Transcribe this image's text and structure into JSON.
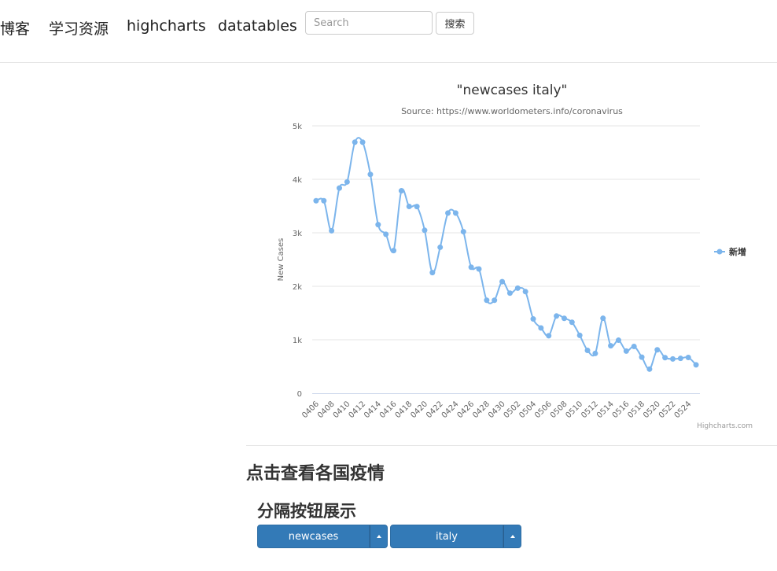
{
  "nav": {
    "blog": "博客",
    "resources": "学习资源",
    "highcharts": "highcharts",
    "datatables": "datatables"
  },
  "search": {
    "placeholder": "Search",
    "button_label": "搜索"
  },
  "chart_data": {
    "type": "line",
    "title": "\"newcases italy\"",
    "subtitle": "Source: https://www.worldometers.info/coronavirus",
    "ylabel": "New Cases",
    "xlabel": "",
    "ylim": [
      0,
      5000
    ],
    "yticks": [
      0,
      1000,
      2000,
      3000,
      4000,
      5000
    ],
    "ytick_labels": [
      "0",
      "1k",
      "2k",
      "3k",
      "4k",
      "5k"
    ],
    "grid": true,
    "legend_position": "right",
    "credits": "Highcharts.com",
    "color": "#7cb5ec",
    "categories": [
      "0406",
      "0407",
      "0408",
      "0409",
      "0410",
      "0411",
      "0412",
      "0413",
      "0414",
      "0415",
      "0416",
      "0417",
      "0418",
      "0419",
      "0420",
      "0421",
      "0422",
      "0423",
      "0424",
      "0425",
      "0426",
      "0427",
      "0428",
      "0429",
      "0430",
      "0501",
      "0502",
      "0503",
      "0504",
      "0505",
      "0506",
      "0507",
      "0508",
      "0509",
      "0510",
      "0511",
      "0512",
      "0513",
      "0514",
      "0515",
      "0516",
      "0517",
      "0518",
      "0519",
      "0520",
      "0521",
      "0522",
      "0523",
      "0524",
      "0525"
    ],
    "tick_labels": [
      "0406",
      "0408",
      "0410",
      "0412",
      "0414",
      "0416",
      "0418",
      "0420",
      "0422",
      "0424",
      "0426",
      "0428",
      "0430",
      "0502",
      "0504",
      "0506",
      "0508",
      "0510",
      "0512",
      "0514",
      "0516",
      "0518",
      "0520",
      "0522",
      "0524"
    ],
    "series": [
      {
        "name": "新增",
        "values": [
          3599,
          3599,
          3039,
          3836,
          3951,
          4694,
          4694,
          4092,
          3153,
          2972,
          2667,
          3786,
          3493,
          3491,
          3047,
          2256,
          2729,
          3370,
          3370,
          3021,
          2357,
          2324,
          1739,
          1739,
          2086,
          1872,
          1965,
          1900,
          1389,
          1221,
          1075,
          1444,
          1401,
          1327,
          1083,
          802,
          744,
          1402,
          888,
          992,
          789,
          875,
          675,
          451,
          813,
          665,
          642,
          652,
          669,
          531
        ]
      }
    ]
  },
  "section": {
    "heading": "点击查看各国疫情",
    "subheading": "分隔按钮展示"
  },
  "dropdowns": {
    "metric_label": "newcases",
    "country_label": "italy"
  }
}
